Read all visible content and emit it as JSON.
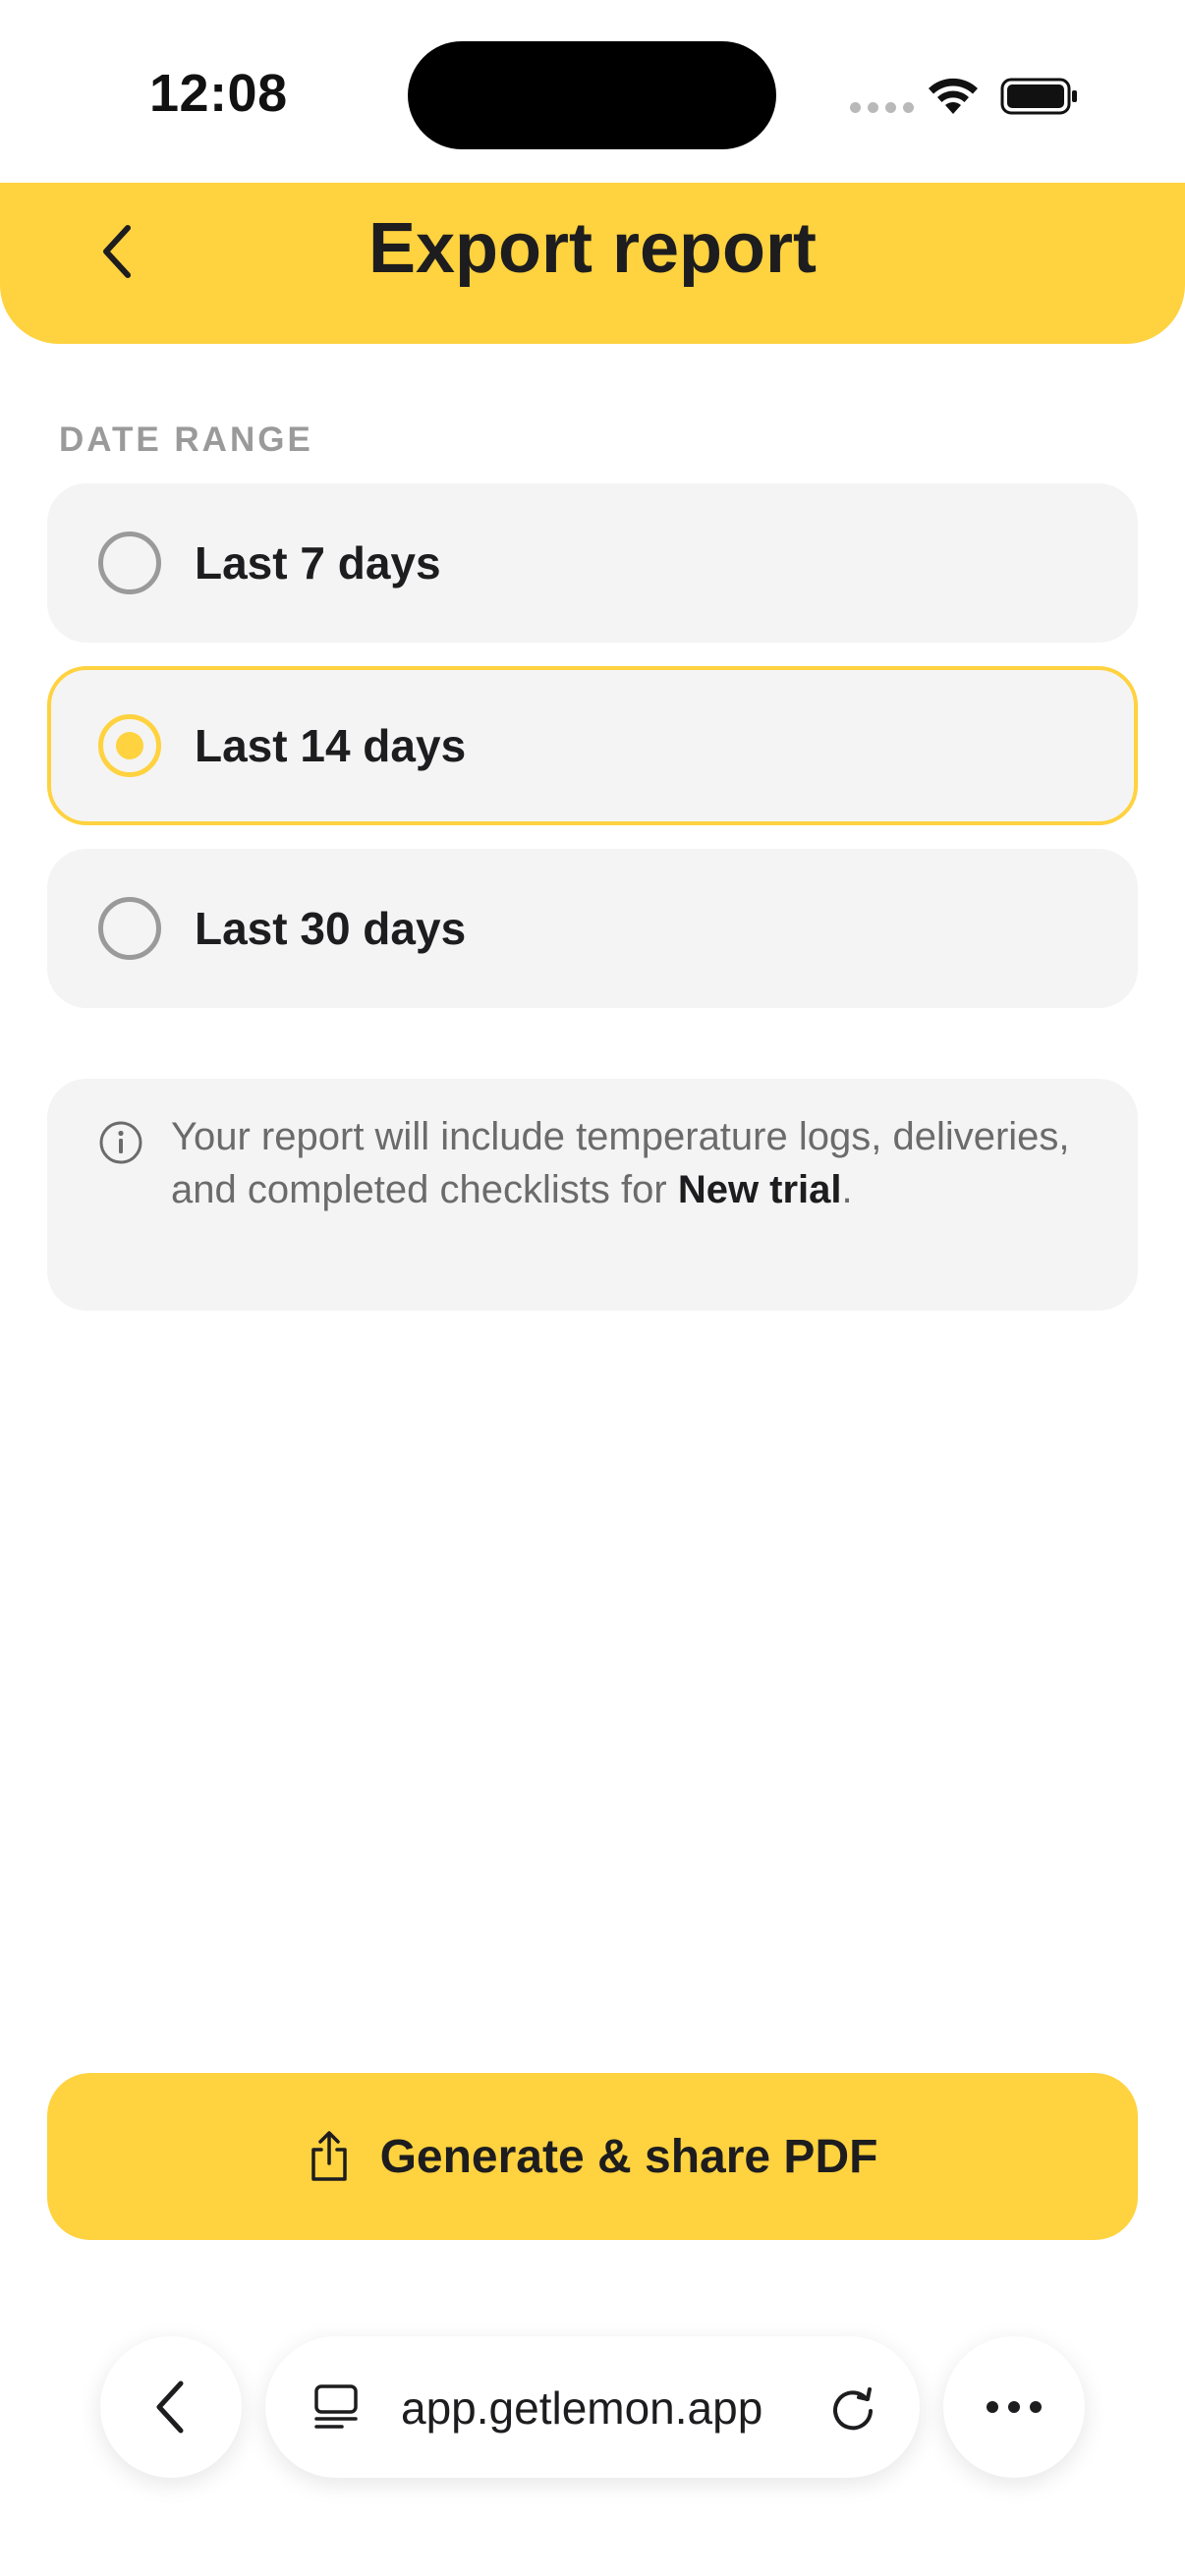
{
  "status_bar": {
    "time": "12:08"
  },
  "header": {
    "title": "Export report"
  },
  "date_range": {
    "label": "DATE RANGE",
    "options": [
      {
        "label": "Last 7 days",
        "selected": false
      },
      {
        "label": "Last 14 days",
        "selected": true
      },
      {
        "label": "Last 30 days",
        "selected": false
      }
    ]
  },
  "info": {
    "text_before": "Your report will include temperature logs, deliveries, and completed checklists for ",
    "highlight": "New trial",
    "text_after": "."
  },
  "primary_action": {
    "label": "Generate & share PDF"
  },
  "browser": {
    "url": "app.getlemon.app"
  },
  "colors": {
    "accent": "#ffd23f",
    "card_bg": "#f4f4f4",
    "muted_text": "#9a9a9a",
    "body_text": "#1d1d1f"
  },
  "icons": {
    "back": "chevron-left-icon",
    "wifi": "wifi-icon",
    "battery": "battery-icon",
    "info": "info-circle-icon",
    "share": "share-icon",
    "tabs": "tabs-icon",
    "reload": "reload-icon",
    "more": "more-icon"
  }
}
